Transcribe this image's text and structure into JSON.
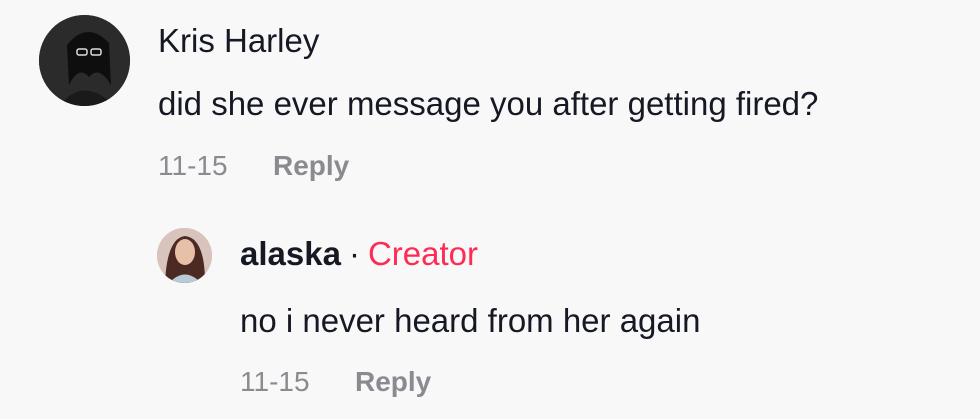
{
  "comments": [
    {
      "author": "Kris Harley",
      "text": "did she ever message you after getting fired?",
      "date": "11-15",
      "reply_label": "Reply",
      "replies": [
        {
          "author": "alaska",
          "separator": "·",
          "badge": "Creator",
          "text": "no i never heard from her again",
          "date": "11-15",
          "reply_label": "Reply"
        }
      ]
    }
  ],
  "colors": {
    "background": "#f8f8f8",
    "text": "#161823",
    "muted": "#8a8b91",
    "creator_badge": "#fe2c55"
  }
}
